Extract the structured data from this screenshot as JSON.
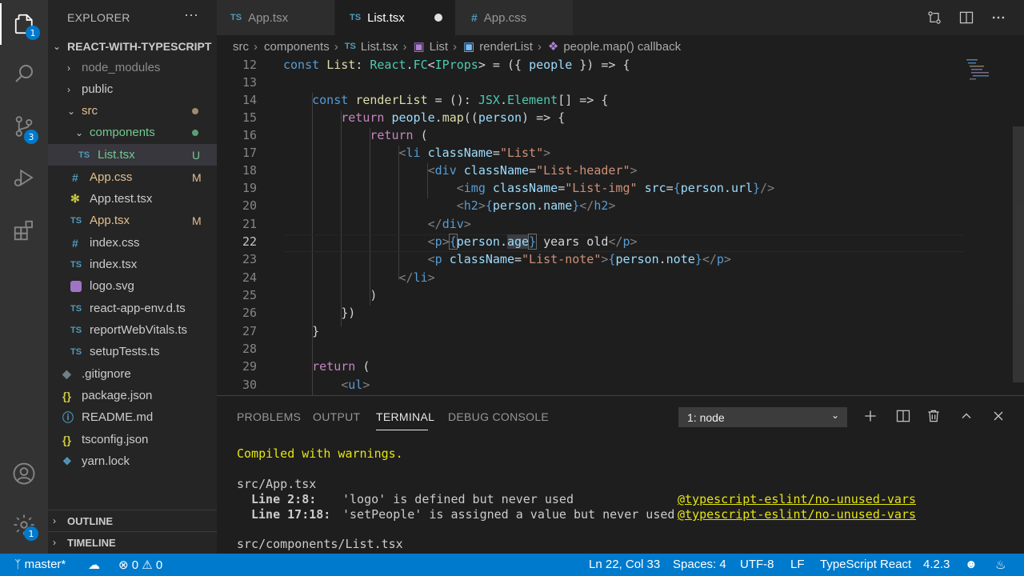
{
  "activity": {
    "explorer_badge": "1",
    "scm_badge": "3",
    "settings_badge": "1"
  },
  "sidebar": {
    "title": "EXPLORER",
    "more": "···",
    "root": "REACT-WITH-TYPESCRIPT",
    "items": [
      {
        "label": "node_modules"
      },
      {
        "label": "public"
      },
      {
        "label": "src"
      },
      {
        "label": "components"
      },
      {
        "label": "List.tsx",
        "icon": "TS",
        "status": "U"
      },
      {
        "label": "App.css",
        "icon": "#",
        "status": "M"
      },
      {
        "label": "App.test.tsx"
      },
      {
        "label": "App.tsx",
        "icon": "TS",
        "status": "M"
      },
      {
        "label": "index.css",
        "icon": "#"
      },
      {
        "label": "index.tsx",
        "icon": "TS"
      },
      {
        "label": "logo.svg"
      },
      {
        "label": "react-app-env.d.ts",
        "icon": "TS"
      },
      {
        "label": "reportWebVitals.ts",
        "icon": "TS"
      },
      {
        "label": "setupTests.ts",
        "icon": "TS"
      },
      {
        "label": ".gitignore"
      },
      {
        "label": "package.json",
        "icon": "{}"
      },
      {
        "label": "README.md"
      },
      {
        "label": "tsconfig.json",
        "icon": "{}"
      },
      {
        "label": "yarn.lock"
      }
    ],
    "outline": "OUTLINE",
    "timeline": "TIMELINE"
  },
  "tabs": [
    {
      "label": "App.tsx",
      "icon": "TS"
    },
    {
      "label": "List.tsx",
      "icon": "TS"
    },
    {
      "label": "App.css",
      "icon": "#"
    }
  ],
  "breadcrumb": [
    "src",
    "components",
    "List.tsx",
    "List",
    "renderList",
    "people.map() callback"
  ],
  "breadcrumb_icons": [
    "TS"
  ],
  "editor": {
    "line_numbers": [
      "12",
      "13",
      "14",
      "15",
      "16",
      "17",
      "18",
      "19",
      "20",
      "21",
      "22",
      "23",
      "24",
      "25",
      "26",
      "27",
      "28",
      "29",
      "30"
    ],
    "code": {
      "l12": {
        "a": "const",
        "b": "List",
        "c": ": ",
        "d": "React",
        "e": ".",
        "f": "FC",
        "g": "<",
        "h": "IProps",
        "i": "> = ({ ",
        "j": "people",
        "k": " }) => {"
      },
      "l14": {
        "a": "const",
        "b": "renderList",
        "c": " = (): ",
        "d": "JSX",
        "e": ".",
        "f": "Element",
        "g": "[] => {"
      },
      "l15": {
        "a": "return",
        "b": "people",
        "c": ".",
        "d": "map",
        "e": "((",
        "f": "person",
        "g": ") => {"
      },
      "l16": {
        "a": "return",
        "b": " ("
      },
      "l17": {
        "a": "<",
        "b": "li",
        "c": "className",
        "d": "=",
        "e": "\"List\"",
        "f": ">"
      },
      "l18": {
        "a": "<",
        "b": "div",
        "c": "className",
        "d": "=",
        "e": "\"List-header\"",
        "f": ">"
      },
      "l19": {
        "a": "<",
        "b": "img",
        "c": "className",
        "d": "=",
        "e": "\"List-img\"",
        "f": "src",
        "g": "=",
        "h": "{",
        "i": "person",
        "j": ".",
        "k": "url",
        "l": "}",
        "m": "/>"
      },
      "l20": {
        "a": "<",
        "b": "h2",
        "c": ">",
        "d": "{",
        "e": "person",
        "f": ".",
        "g": "name",
        "h": "}",
        "i": "</",
        "j": "h2",
        "k": ">"
      },
      "l21": {
        "a": "</",
        "b": "div",
        "c": ">"
      },
      "l22": {
        "a": "<",
        "b": "p",
        "c": ">",
        "d": "{",
        "e": "person",
        "f": ".",
        "g": "age",
        "h": "}",
        "i": " years old",
        "j": "</",
        "k": "p",
        "l": ">"
      },
      "l23": {
        "a": "<",
        "b": "p",
        "c": "className",
        "d": "=",
        "e": "\"List-note\"",
        "f": ">",
        "g": "{",
        "h": "person",
        "i": ".",
        "j": "note",
        "k": "}",
        "l": "</",
        "m": "p",
        "n": ">"
      },
      "l24": {
        "a": "</",
        "b": "li",
        "c": ">"
      },
      "l25": {
        "a": ")"
      },
      "l26": {
        "a": "})"
      },
      "l27": {
        "a": "}"
      },
      "l29": {
        "a": "return",
        "b": " ("
      },
      "l30": {
        "a": "<",
        "b": "ul",
        "c": ">"
      }
    }
  },
  "panel": {
    "tabs": [
      "PROBLEMS",
      "OUTPUT",
      "TERMINAL",
      "DEBUG CONSOLE"
    ],
    "terminal_select": "1: node",
    "terminal": {
      "compiled": "Compiled with warnings.",
      "file1": "src/App.tsx",
      "w1_loc": "Line 2:8:",
      "w1_msg": "'logo' is defined but never used",
      "w1_rule": "@typescript-eslint/no-unused-vars",
      "w2_loc": "Line 17:18:",
      "w2_msg": "'setPeople' is assigned a value but never used",
      "w2_rule": "@typescript-eslint/no-unused-vars",
      "file2": "src/components/List.tsx"
    }
  },
  "statusbar": {
    "branch": "master*",
    "errors": "0",
    "warnings": "0",
    "position": "Ln 22, Col 33",
    "spaces": "Spaces: 4",
    "encoding": "UTF-8",
    "eol": "LF",
    "language": "TypeScript React",
    "version": "4.2.3"
  },
  "colors": {
    "accent": "#007acc",
    "ts_icon": "#519aba",
    "css_icon": "#519aba",
    "git_untracked": "#73c991",
    "git_modified": "#e2c08d",
    "json_icon": "#cbcb41"
  }
}
